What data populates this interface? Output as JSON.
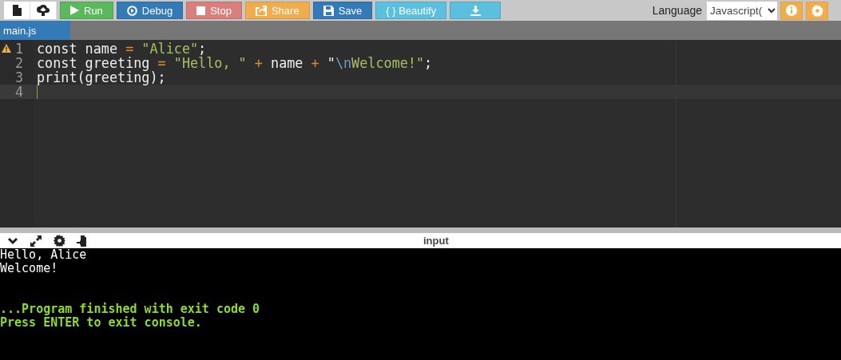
{
  "toolbar": {
    "file_buttons": [
      {
        "kind": "new-file"
      },
      {
        "kind": "upload"
      }
    ],
    "buttons": [
      {
        "label": "Run",
        "kind": "run",
        "color": "#5cb85c"
      },
      {
        "label": "Debug",
        "kind": "debug",
        "color": "#337ab7"
      },
      {
        "label": "Stop",
        "kind": "stop",
        "color": "#d9807c"
      },
      {
        "label": "Share",
        "kind": "share",
        "color": "#f0ad4e"
      },
      {
        "label": "Save",
        "kind": "save",
        "color": "#337ab7"
      },
      {
        "label": "{ } Beautify",
        "kind": "none",
        "color": "#5bc0de"
      },
      {
        "kind": "download",
        "color": "#5bc0de"
      }
    ],
    "language_label": "Language",
    "language_value": "Javascript("
  },
  "tabs": [
    {
      "label": "main.js",
      "selected": true
    }
  ],
  "editor": {
    "lines": [
      {
        "number": "1",
        "warning": true,
        "active": false,
        "tokens": [
          {
            "kind": "plain",
            "text": "const name "
          },
          {
            "kind": "op",
            "text": "= "
          },
          {
            "kind": "string",
            "text": "\"Alice\""
          },
          {
            "kind": "plain",
            "text": ";"
          }
        ]
      },
      {
        "number": "2",
        "warning": false,
        "active": false,
        "tokens": [
          {
            "kind": "plain",
            "text": "const greeting "
          },
          {
            "kind": "op",
            "text": "= "
          },
          {
            "kind": "string",
            "text": "\"Hello, \" "
          },
          {
            "kind": "op",
            "text": "+"
          },
          {
            "kind": "plain",
            "text": " name "
          },
          {
            "kind": "op",
            "text": "+ "
          },
          {
            "kind": "plain",
            "text": "\""
          },
          {
            "kind": "escape",
            "text": "\\n"
          },
          {
            "kind": "string",
            "text": "Welcome!\""
          },
          {
            "kind": "plain",
            "text": ";"
          }
        ]
      },
      {
        "number": "3",
        "warning": false,
        "active": false,
        "tokens": [
          {
            "kind": "plain",
            "text": "print(greeting);"
          }
        ]
      },
      {
        "number": "4",
        "warning": false,
        "active": true
      }
    ]
  },
  "console": {
    "title": "input",
    "lines": [
      {
        "kind": "output",
        "text": "Hello, Alice"
      },
      {
        "kind": "output",
        "text": "Welcome!"
      },
      {
        "kind": "status",
        "text": "...Program finished with exit code 0"
      },
      {
        "kind": "status",
        "text": "Press ENTER to exit console."
      }
    ]
  }
}
